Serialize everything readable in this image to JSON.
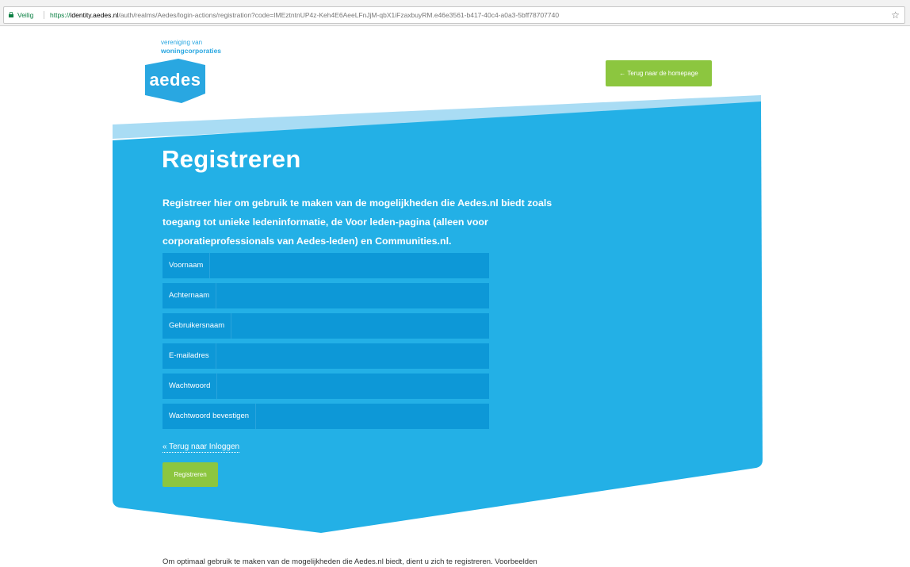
{
  "browser": {
    "secure_label": "Veilig",
    "url_protocol": "https://",
    "url_host": "identity.aedes.nl",
    "url_path": "/auth/realms/Aedes/login-actions/registration?code=IMEztntnUP4z-Keh4E6AeeLFnJjM-qbX1iFzaxbuyRM.e46e3561-b417-40c4-a0a3-5bff78707740",
    "star_icon": "star-icon"
  },
  "logo": {
    "tagline_line1": "vereniging van",
    "tagline_line2": "woningcorporaties",
    "wordmark": "aedes"
  },
  "header": {
    "home_button_label": "←  Terug naar de homepage"
  },
  "main": {
    "title": "Registreren",
    "intro": "Registreer hier om gebruik te maken van de mogelijkheden die Aedes.nl biedt zoals toegang tot unieke ledeninformatie, de Voor leden-pagina (alleen voor corporatieprofessionals van Aedes-leden) en Communities.nl.",
    "fields": [
      {
        "label": "Voornaam",
        "value": ""
      },
      {
        "label": "Achternaam",
        "value": ""
      },
      {
        "label": "Gebruikersnaam",
        "value": ""
      },
      {
        "label": "E-mailadres",
        "value": ""
      },
      {
        "label": "Wachtwoord",
        "value": ""
      },
      {
        "label": "Wachtwoord bevestigen",
        "value": ""
      }
    ],
    "back_link": "« Terug naar Inloggen",
    "register_button": "Registreren"
  },
  "footer": {
    "text": "Om optimaal gebruik te maken van de mogelijkheden die Aedes.nl biedt, dient u zich te registreren. Voorbeelden"
  },
  "colors": {
    "panel_blue": "#23b0e6",
    "field_blue": "#0d98d7",
    "light_band": "#a9dcf4",
    "accent_green": "#8cc63f",
    "brand_blue": "#29a7e1"
  }
}
